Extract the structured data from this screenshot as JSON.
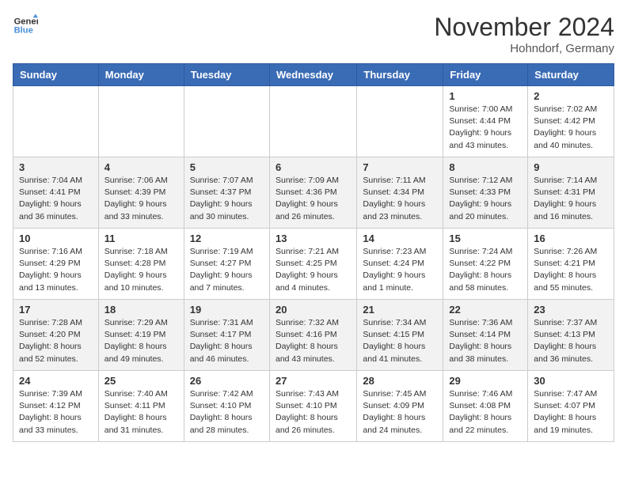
{
  "header": {
    "logo_general": "General",
    "logo_blue": "Blue",
    "month_title": "November 2024",
    "location": "Hohndorf, Germany"
  },
  "days_of_week": [
    "Sunday",
    "Monday",
    "Tuesday",
    "Wednesday",
    "Thursday",
    "Friday",
    "Saturday"
  ],
  "weeks": [
    [
      {
        "day": "",
        "info": ""
      },
      {
        "day": "",
        "info": ""
      },
      {
        "day": "",
        "info": ""
      },
      {
        "day": "",
        "info": ""
      },
      {
        "day": "",
        "info": ""
      },
      {
        "day": "1",
        "info": "Sunrise: 7:00 AM\nSunset: 4:44 PM\nDaylight: 9 hours\nand 43 minutes."
      },
      {
        "day": "2",
        "info": "Sunrise: 7:02 AM\nSunset: 4:42 PM\nDaylight: 9 hours\nand 40 minutes."
      }
    ],
    [
      {
        "day": "3",
        "info": "Sunrise: 7:04 AM\nSunset: 4:41 PM\nDaylight: 9 hours\nand 36 minutes."
      },
      {
        "day": "4",
        "info": "Sunrise: 7:06 AM\nSunset: 4:39 PM\nDaylight: 9 hours\nand 33 minutes."
      },
      {
        "day": "5",
        "info": "Sunrise: 7:07 AM\nSunset: 4:37 PM\nDaylight: 9 hours\nand 30 minutes."
      },
      {
        "day": "6",
        "info": "Sunrise: 7:09 AM\nSunset: 4:36 PM\nDaylight: 9 hours\nand 26 minutes."
      },
      {
        "day": "7",
        "info": "Sunrise: 7:11 AM\nSunset: 4:34 PM\nDaylight: 9 hours\nand 23 minutes."
      },
      {
        "day": "8",
        "info": "Sunrise: 7:12 AM\nSunset: 4:33 PM\nDaylight: 9 hours\nand 20 minutes."
      },
      {
        "day": "9",
        "info": "Sunrise: 7:14 AM\nSunset: 4:31 PM\nDaylight: 9 hours\nand 16 minutes."
      }
    ],
    [
      {
        "day": "10",
        "info": "Sunrise: 7:16 AM\nSunset: 4:29 PM\nDaylight: 9 hours\nand 13 minutes."
      },
      {
        "day": "11",
        "info": "Sunrise: 7:18 AM\nSunset: 4:28 PM\nDaylight: 9 hours\nand 10 minutes."
      },
      {
        "day": "12",
        "info": "Sunrise: 7:19 AM\nSunset: 4:27 PM\nDaylight: 9 hours\nand 7 minutes."
      },
      {
        "day": "13",
        "info": "Sunrise: 7:21 AM\nSunset: 4:25 PM\nDaylight: 9 hours\nand 4 minutes."
      },
      {
        "day": "14",
        "info": "Sunrise: 7:23 AM\nSunset: 4:24 PM\nDaylight: 9 hours\nand 1 minute."
      },
      {
        "day": "15",
        "info": "Sunrise: 7:24 AM\nSunset: 4:22 PM\nDaylight: 8 hours\nand 58 minutes."
      },
      {
        "day": "16",
        "info": "Sunrise: 7:26 AM\nSunset: 4:21 PM\nDaylight: 8 hours\nand 55 minutes."
      }
    ],
    [
      {
        "day": "17",
        "info": "Sunrise: 7:28 AM\nSunset: 4:20 PM\nDaylight: 8 hours\nand 52 minutes."
      },
      {
        "day": "18",
        "info": "Sunrise: 7:29 AM\nSunset: 4:19 PM\nDaylight: 8 hours\nand 49 minutes."
      },
      {
        "day": "19",
        "info": "Sunrise: 7:31 AM\nSunset: 4:17 PM\nDaylight: 8 hours\nand 46 minutes."
      },
      {
        "day": "20",
        "info": "Sunrise: 7:32 AM\nSunset: 4:16 PM\nDaylight: 8 hours\nand 43 minutes."
      },
      {
        "day": "21",
        "info": "Sunrise: 7:34 AM\nSunset: 4:15 PM\nDaylight: 8 hours\nand 41 minutes."
      },
      {
        "day": "22",
        "info": "Sunrise: 7:36 AM\nSunset: 4:14 PM\nDaylight: 8 hours\nand 38 minutes."
      },
      {
        "day": "23",
        "info": "Sunrise: 7:37 AM\nSunset: 4:13 PM\nDaylight: 8 hours\nand 36 minutes."
      }
    ],
    [
      {
        "day": "24",
        "info": "Sunrise: 7:39 AM\nSunset: 4:12 PM\nDaylight: 8 hours\nand 33 minutes."
      },
      {
        "day": "25",
        "info": "Sunrise: 7:40 AM\nSunset: 4:11 PM\nDaylight: 8 hours\nand 31 minutes."
      },
      {
        "day": "26",
        "info": "Sunrise: 7:42 AM\nSunset: 4:10 PM\nDaylight: 8 hours\nand 28 minutes."
      },
      {
        "day": "27",
        "info": "Sunrise: 7:43 AM\nSunset: 4:10 PM\nDaylight: 8 hours\nand 26 minutes."
      },
      {
        "day": "28",
        "info": "Sunrise: 7:45 AM\nSunset: 4:09 PM\nDaylight: 8 hours\nand 24 minutes."
      },
      {
        "day": "29",
        "info": "Sunrise: 7:46 AM\nSunset: 4:08 PM\nDaylight: 8 hours\nand 22 minutes."
      },
      {
        "day": "30",
        "info": "Sunrise: 7:47 AM\nSunset: 4:07 PM\nDaylight: 8 hours\nand 19 minutes."
      }
    ]
  ]
}
